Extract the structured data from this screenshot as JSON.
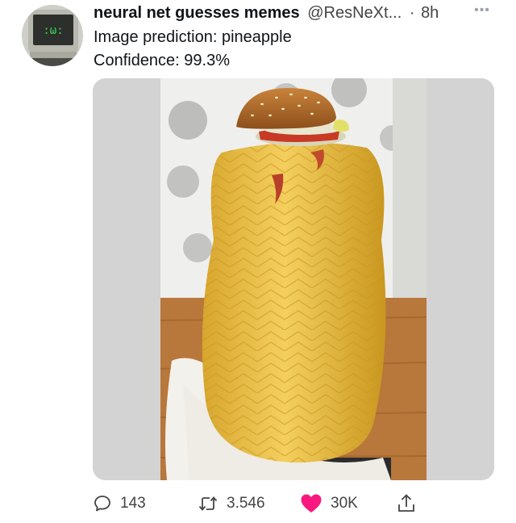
{
  "tweet": {
    "display_name": "neural net guesses memes",
    "handle": "@ResNeXt...",
    "separator": "·",
    "time": "8h",
    "more_label": "•••",
    "lines": [
      "Image prediction: pineapple",
      "Confidence: 99.3%"
    ],
    "avatar_icon": "retro-computer-smile-icon",
    "media_icon": "cheese-tower-burger-photo"
  },
  "actions": {
    "reply": {
      "icon": "speech-bubble-icon",
      "count": "143"
    },
    "retweet": {
      "icon": "retweet-arrows-icon",
      "count": "3.546"
    },
    "like": {
      "icon": "heart-icon",
      "count": "30K",
      "color": "#f91880"
    },
    "share": {
      "icon": "share-up-arrow-icon",
      "count": ""
    }
  },
  "colors": {
    "text": "#0f1419",
    "secondary": "#444444",
    "media_background": "#d3d3d3",
    "like": "#f91880"
  }
}
